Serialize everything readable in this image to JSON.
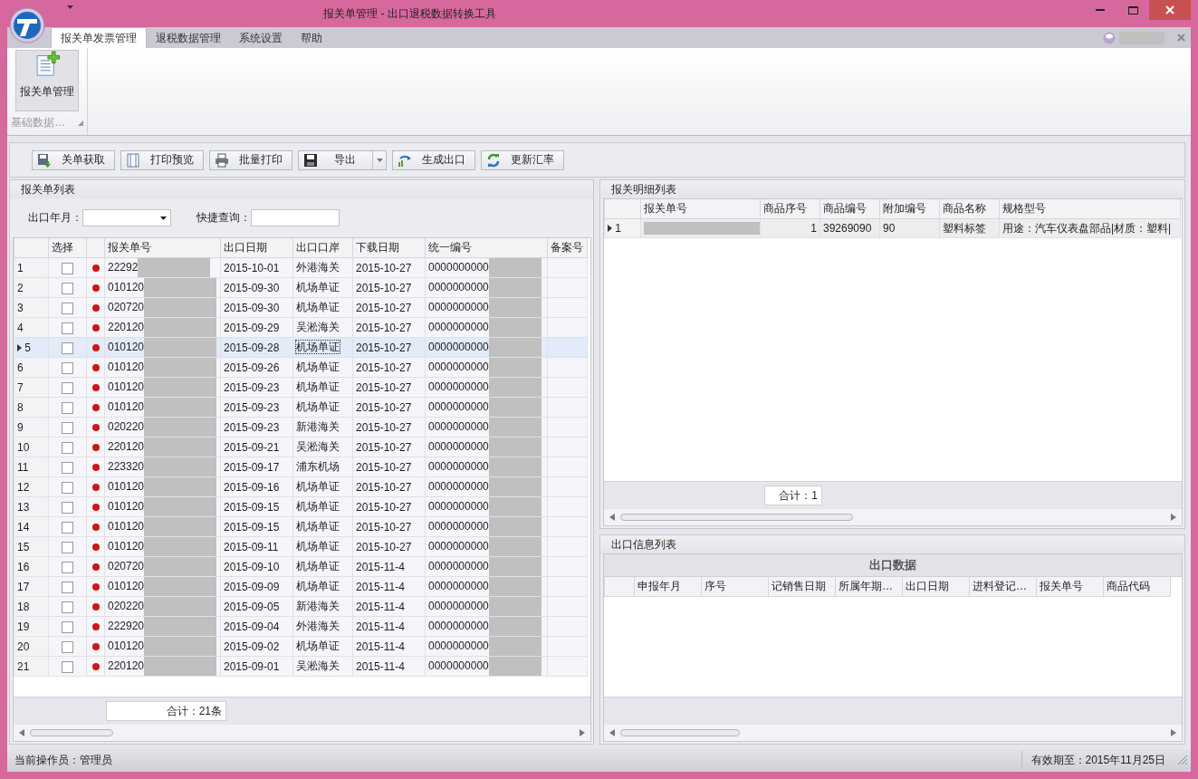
{
  "window": {
    "title": "报关单管理 - 出口退税数据转换工具"
  },
  "ribbon": {
    "tabs": [
      {
        "label": "报关单发票管理",
        "selected": true
      },
      {
        "label": "退税数据管理",
        "selected": false
      },
      {
        "label": "系统设置",
        "selected": false
      },
      {
        "label": "帮助",
        "selected": false
      }
    ],
    "button": "报关单管理",
    "group": "基础数据…"
  },
  "toolbar": [
    {
      "label": "关单获取",
      "kind": "fetch"
    },
    {
      "label": "打印预览",
      "kind": "preview"
    },
    {
      "label": "批量打印",
      "kind": "print"
    },
    {
      "label": "导出",
      "kind": "export",
      "dropdown": true
    },
    {
      "label": "生成出口",
      "kind": "generate"
    },
    {
      "label": "更新汇率",
      "kind": "refresh"
    }
  ],
  "list_panel": {
    "title": "报关单列表",
    "filters": [
      {
        "label": "出口年月：",
        "kind": "dropdown"
      },
      {
        "label": "快捷查询：",
        "kind": "text"
      }
    ],
    "columns": [
      {
        "label": "选择",
        "kind": "check"
      },
      {
        "kind": "dot"
      },
      {
        "label": "报关单号",
        "kind": "redacted"
      },
      {
        "label": "出口日期",
        "kind": "text"
      },
      {
        "label": "出口口岸",
        "kind": "text"
      },
      {
        "label": "下载日期",
        "kind": "text"
      },
      {
        "label": "统一编号",
        "kind": "redacted"
      },
      {
        "label": "备案号",
        "kind": "text"
      }
    ],
    "rows": [
      {
        "no": "1",
        "checked": false,
        "selected": false,
        "cells": [
          "",
          "",
          "22292",
          "2015-10-01",
          "外港海关",
          "2015-10-27",
          "0000000000"
        ]
      },
      {
        "no": "2",
        "checked": false,
        "selected": false,
        "cells": [
          "",
          "",
          "010120",
          "2015-09-30",
          "机场单证",
          "2015-10-27",
          "0000000000"
        ]
      },
      {
        "no": "3",
        "checked": false,
        "selected": false,
        "cells": [
          "",
          "",
          "020720",
          "2015-09-30",
          "机场单证",
          "2015-10-27",
          "0000000000"
        ]
      },
      {
        "no": "4",
        "checked": false,
        "selected": false,
        "cells": [
          "",
          "",
          "220120",
          "2015-09-29",
          "吴淞海关",
          "2015-10-27",
          "0000000000"
        ]
      },
      {
        "no": "5",
        "checked": false,
        "selected": true,
        "cells": [
          "",
          "",
          "010120",
          "2015-09-28",
          "机场单证",
          "2015-10-27",
          "0000000000"
        ]
      },
      {
        "no": "6",
        "checked": false,
        "selected": false,
        "cells": [
          "",
          "",
          "010120",
          "2015-09-26",
          "机场单证",
          "2015-10-27",
          "0000000000"
        ]
      },
      {
        "no": "7",
        "checked": false,
        "selected": false,
        "cells": [
          "",
          "",
          "010120",
          "2015-09-23",
          "机场单证",
          "2015-10-27",
          "0000000000"
        ]
      },
      {
        "no": "8",
        "checked": false,
        "selected": false,
        "cells": [
          "",
          "",
          "010120",
          "2015-09-23",
          "机场单证",
          "2015-10-27",
          "0000000000"
        ]
      },
      {
        "no": "9",
        "checked": false,
        "selected": false,
        "cells": [
          "",
          "",
          "020220",
          "2015-09-23",
          "新港海关",
          "2015-10-27",
          "0000000000"
        ]
      },
      {
        "no": "10",
        "checked": false,
        "selected": false,
        "cells": [
          "",
          "",
          "220120",
          "2015-09-21",
          "吴淞海关",
          "2015-10-27",
          "0000000000"
        ]
      },
      {
        "no": "11",
        "checked": false,
        "selected": false,
        "cells": [
          "",
          "",
          "223320",
          "2015-09-17",
          "浦东机场",
          "2015-10-27",
          "0000000000"
        ]
      },
      {
        "no": "12",
        "checked": false,
        "selected": false,
        "cells": [
          "",
          "",
          "010120",
          "2015-09-16",
          "机场单证",
          "2015-10-27",
          "0000000000"
        ]
      },
      {
        "no": "13",
        "checked": false,
        "selected": false,
        "cells": [
          "",
          "",
          "010120",
          "2015-09-15",
          "机场单证",
          "2015-10-27",
          "0000000000"
        ]
      },
      {
        "no": "14",
        "checked": false,
        "selected": false,
        "cells": [
          "",
          "",
          "010120",
          "2015-09-15",
          "机场单证",
          "2015-10-27",
          "0000000000"
        ]
      },
      {
        "no": "15",
        "checked": false,
        "selected": false,
        "cells": [
          "",
          "",
          "010120",
          "2015-09-11",
          "机场单证",
          "2015-10-27",
          "0000000000"
        ]
      },
      {
        "no": "16",
        "checked": false,
        "selected": false,
        "cells": [
          "",
          "",
          "020720",
          "2015-09-10",
          "机场单证",
          "2015-11-4",
          "0000000000"
        ]
      },
      {
        "no": "17",
        "checked": false,
        "selected": false,
        "cells": [
          "",
          "",
          "010120",
          "2015-09-09",
          "机场单证",
          "2015-11-4",
          "0000000000"
        ]
      },
      {
        "no": "18",
        "checked": false,
        "selected": false,
        "cells": [
          "",
          "",
          "020220",
          "2015-09-05",
          "新港海关",
          "2015-11-4",
          "0000000000"
        ]
      },
      {
        "no": "19",
        "checked": false,
        "selected": false,
        "cells": [
          "",
          "",
          "222920",
          "2015-09-04",
          "外港海关",
          "2015-11-4",
          "0000000000"
        ]
      },
      {
        "no": "20",
        "checked": false,
        "selected": false,
        "cells": [
          "",
          "",
          "010120",
          "2015-09-02",
          "机场单证",
          "2015-11-4",
          "0000000000"
        ]
      },
      {
        "no": "21",
        "checked": false,
        "selected": false,
        "cells": [
          "",
          "",
          "220120",
          "2015-09-01",
          "吴淞海关",
          "2015-11-4",
          "0000000000"
        ]
      }
    ],
    "total": "合计：21条"
  },
  "detail_panel": {
    "title": "报关明细列表",
    "columns": [
      {
        "label": "报关单号",
        "kind": "redacted"
      },
      {
        "label": "商品序号",
        "kind": "number"
      },
      {
        "label": "商品编号",
        "kind": "text"
      },
      {
        "label": "附加编号",
        "kind": "text"
      },
      {
        "label": "商品名称",
        "kind": "text"
      },
      {
        "label": "规格型号",
        "kind": "text"
      }
    ],
    "rows": [
      {
        "no": "1",
        "selected": true,
        "cells": [
          "",
          "1",
          "39269090",
          "90",
          "塑料标签",
          "用途：汽车仪表盘部品|材质：塑料|"
        ]
      }
    ],
    "total": "合计：1"
  },
  "export_panel": {
    "title": "出口信息列表",
    "band": "出口数据",
    "columns": [
      "申报年月",
      "序号",
      "记销售日期",
      "所属年期…",
      "出口日期",
      "进料登记…",
      "报关单号",
      "商品代码"
    ]
  },
  "status_bar": {
    "operator": "当前操作员：管理员",
    "expiry": "有效期至：2015年11月25日"
  }
}
